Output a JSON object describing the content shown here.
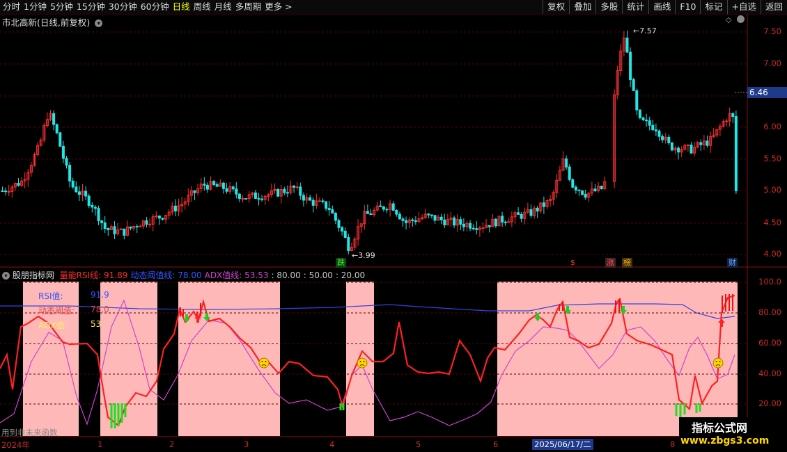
{
  "toolbar": {
    "periods": [
      "分时",
      "1分钟",
      "5分钟",
      "15分钟",
      "30分钟",
      "60分钟",
      "日线",
      "周线",
      "月线",
      "多周期",
      "更多 >"
    ],
    "active_period": "日线",
    "right_buttons": [
      "复权",
      "叠加",
      "多股",
      "统计",
      "画线",
      "F10",
      "标记",
      "+自选",
      "返回"
    ]
  },
  "main_panel": {
    "title": "市北高新(日线,前复权)",
    "price_axis": [
      "7.50",
      "7.00",
      "6.50",
      "6.00",
      "5.50",
      "5.00",
      "4.50",
      "4.00"
    ],
    "current_price": "6.46",
    "high_marker": "7.57",
    "low_marker": "3.99",
    "tags": [
      {
        "text": "跌",
        "color": "#22cc22"
      },
      {
        "text": "$",
        "color": "#ff3030"
      },
      {
        "text": "涨",
        "color": "#ff5050"
      },
      {
        "text": "榜",
        "color": "#ffaa00"
      },
      {
        "text": "财",
        "color": "#66aaff"
      }
    ]
  },
  "indicator_panel": {
    "name": "股朋指标网",
    "legend": [
      {
        "label": "量能RSI线: 91.89",
        "color": "#ff2a2a"
      },
      {
        "label": "动态阈值线: 78.00",
        "color": "#3355ff"
      },
      {
        "label": "ADX值线: 53.53",
        "color": "#cc44cc"
      },
      {
        "label": ": 80.00",
        "color": "#c8c8c8"
      },
      {
        "label": ": 50.00",
        "color": "#c8c8c8"
      },
      {
        "label": ": 20.00",
        "color": "#c8c8c8"
      }
    ],
    "info_rows": [
      {
        "label": "RSI值:",
        "value": "91.9",
        "label_color": "#3355ff",
        "value_color": "#3355ff"
      },
      {
        "label": "动态阈值:",
        "value": "78.0",
        "label_color": "#dd4444",
        "value_color": "#dd4444"
      },
      {
        "label": "ADX值:",
        "value": "53",
        "label_color": "#ffee66",
        "value_color": "#ffee66"
      }
    ],
    "axis": [
      "100.0",
      "80.00",
      "60.00",
      "40.00",
      "20.00"
    ],
    "bottom_text": "用到非未来函数"
  },
  "x_axis": {
    "labels": [
      "2024年",
      "1",
      "2",
      "3",
      "4",
      "5",
      "6",
      "7",
      "8"
    ],
    "cursor_date": "2025/06/17/二"
  },
  "watermark": {
    "line1": "指标公式网",
    "line2": "www.zbgs3.com"
  },
  "colors": {
    "up": "#ff3030",
    "down": "#22e5e5",
    "rsi": "#ff2020",
    "threshold": "#3344dd",
    "adx": "#cc44cc",
    "zone": "#ffb8b8"
  }
}
